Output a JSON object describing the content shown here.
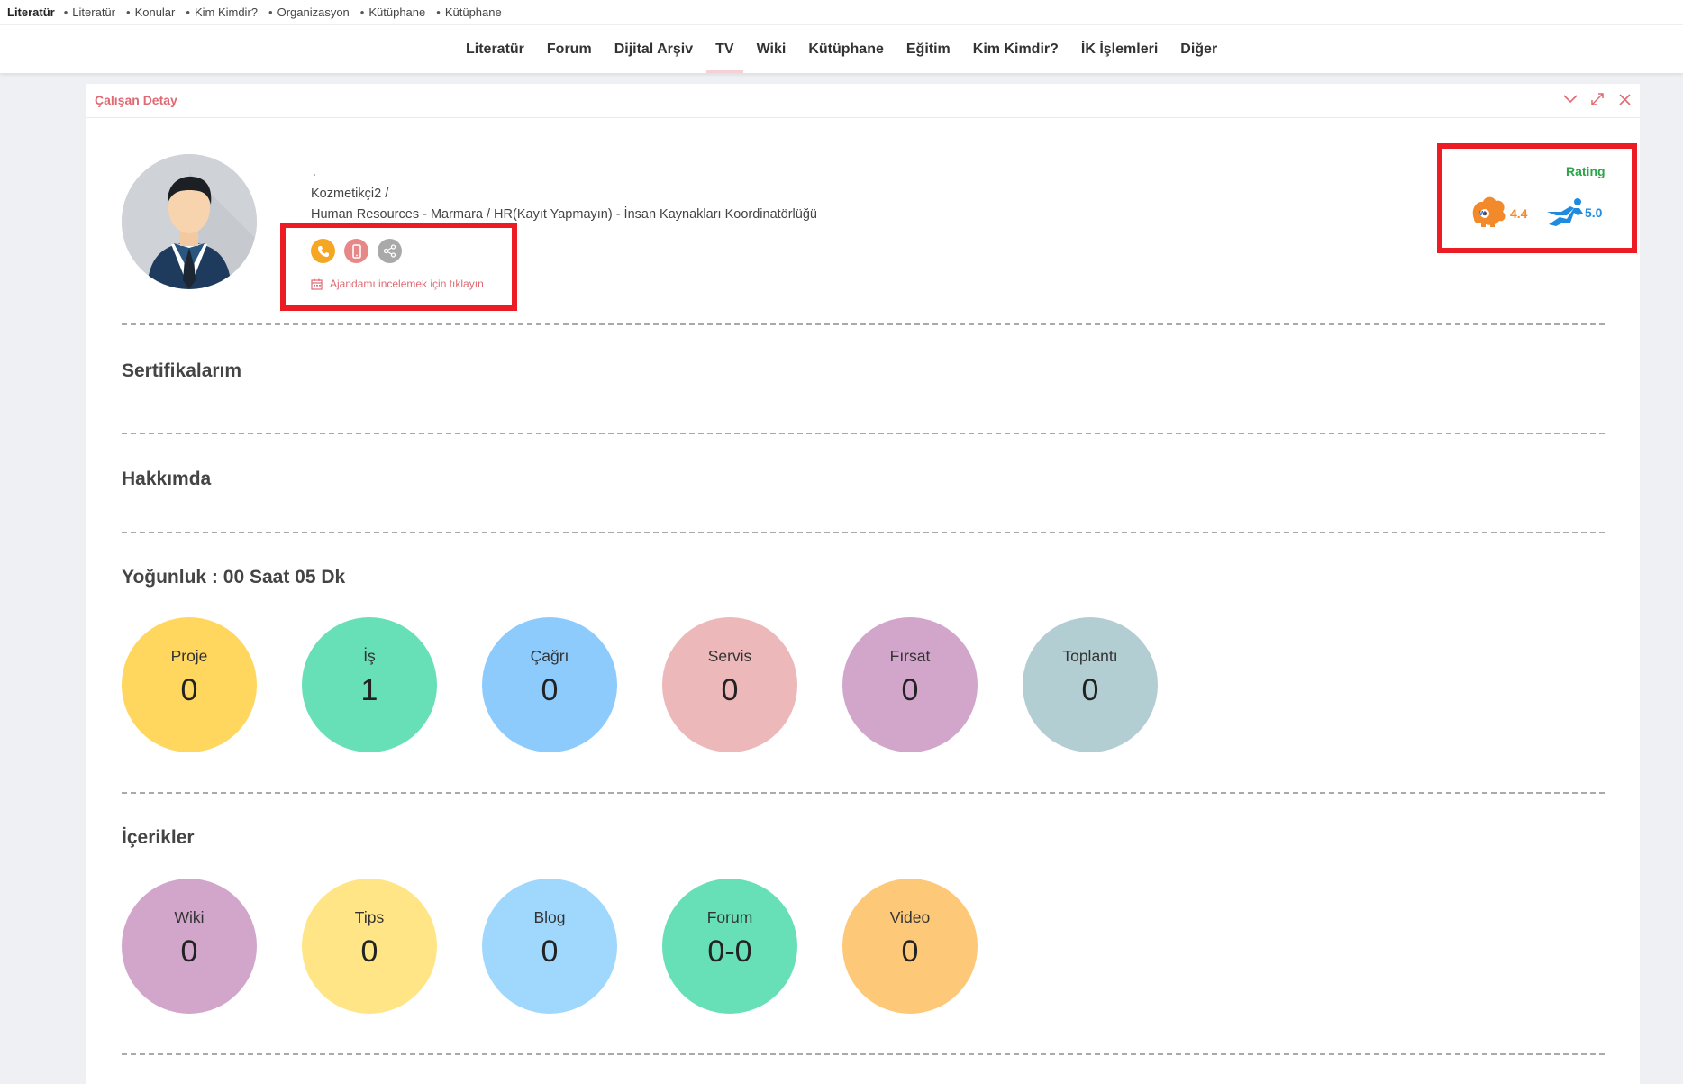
{
  "breadcrumb": {
    "current": "Literatür",
    "items": [
      "Literatür",
      "Konular",
      "Kim Kimdir?",
      "Organizasyon",
      "Kütüphane",
      "Kütüphane"
    ]
  },
  "nav": {
    "items": [
      "Literatür",
      "Forum",
      "Dijital Arşiv",
      "TV",
      "Wiki",
      "Kütüphane",
      "Eğitim",
      "Kim Kimdir?",
      "İK İşlemleri",
      "Diğer"
    ],
    "active": "TV"
  },
  "panel": {
    "title": "Çalışan Detay"
  },
  "profile": {
    "name_line": "Kozmetikçi2 /",
    "org_line": "Human Resources - Marmara / HR(Kayıt Yapmayın) - İnsan Kaynakları Koordinatörlüğü",
    "agenda_link": "Ajandamı incelemek için tıklayın"
  },
  "rating": {
    "label": "Rating",
    "score_one": "4.4",
    "score_two": "5.0"
  },
  "sections": {
    "certificates": "Sertifikalarım",
    "about": "Hakkımda",
    "workload": "Yoğunluk : 00 Saat 05 Dk",
    "contents": "İçerikler"
  },
  "workload_stats": [
    {
      "label": "Proje",
      "value": "0",
      "color": "#ffd75e"
    },
    {
      "label": "İş",
      "value": "1",
      "color": "#67e0b7"
    },
    {
      "label": "Çağrı",
      "value": "0",
      "color": "#8ecbfd"
    },
    {
      "label": "Servis",
      "value": "0",
      "color": "#edb8b9"
    },
    {
      "label": "Fırsat",
      "value": "0",
      "color": "#d1a6ca"
    },
    {
      "label": "Toplantı",
      "value": "0",
      "color": "#b3ced2"
    }
  ],
  "content_stats": [
    {
      "label": "Wiki",
      "value": "0",
      "color": "#d1a6ca"
    },
    {
      "label": "Tips",
      "value": "0",
      "color": "#ffe585"
    },
    {
      "label": "Blog",
      "value": "0",
      "color": "#9fd7fd"
    },
    {
      "label": "Forum",
      "value": "0-0",
      "color": "#67e0b7"
    },
    {
      "label": "Video",
      "value": "0",
      "color": "#fdc878"
    }
  ],
  "colors": {
    "accent": "#e06a73",
    "highlight_red": "#ed1c24",
    "rating_green": "#2ca54a",
    "phone_orange": "#f5a623",
    "mobile_pink": "#e88787",
    "share_gray": "#a9a9a9"
  }
}
